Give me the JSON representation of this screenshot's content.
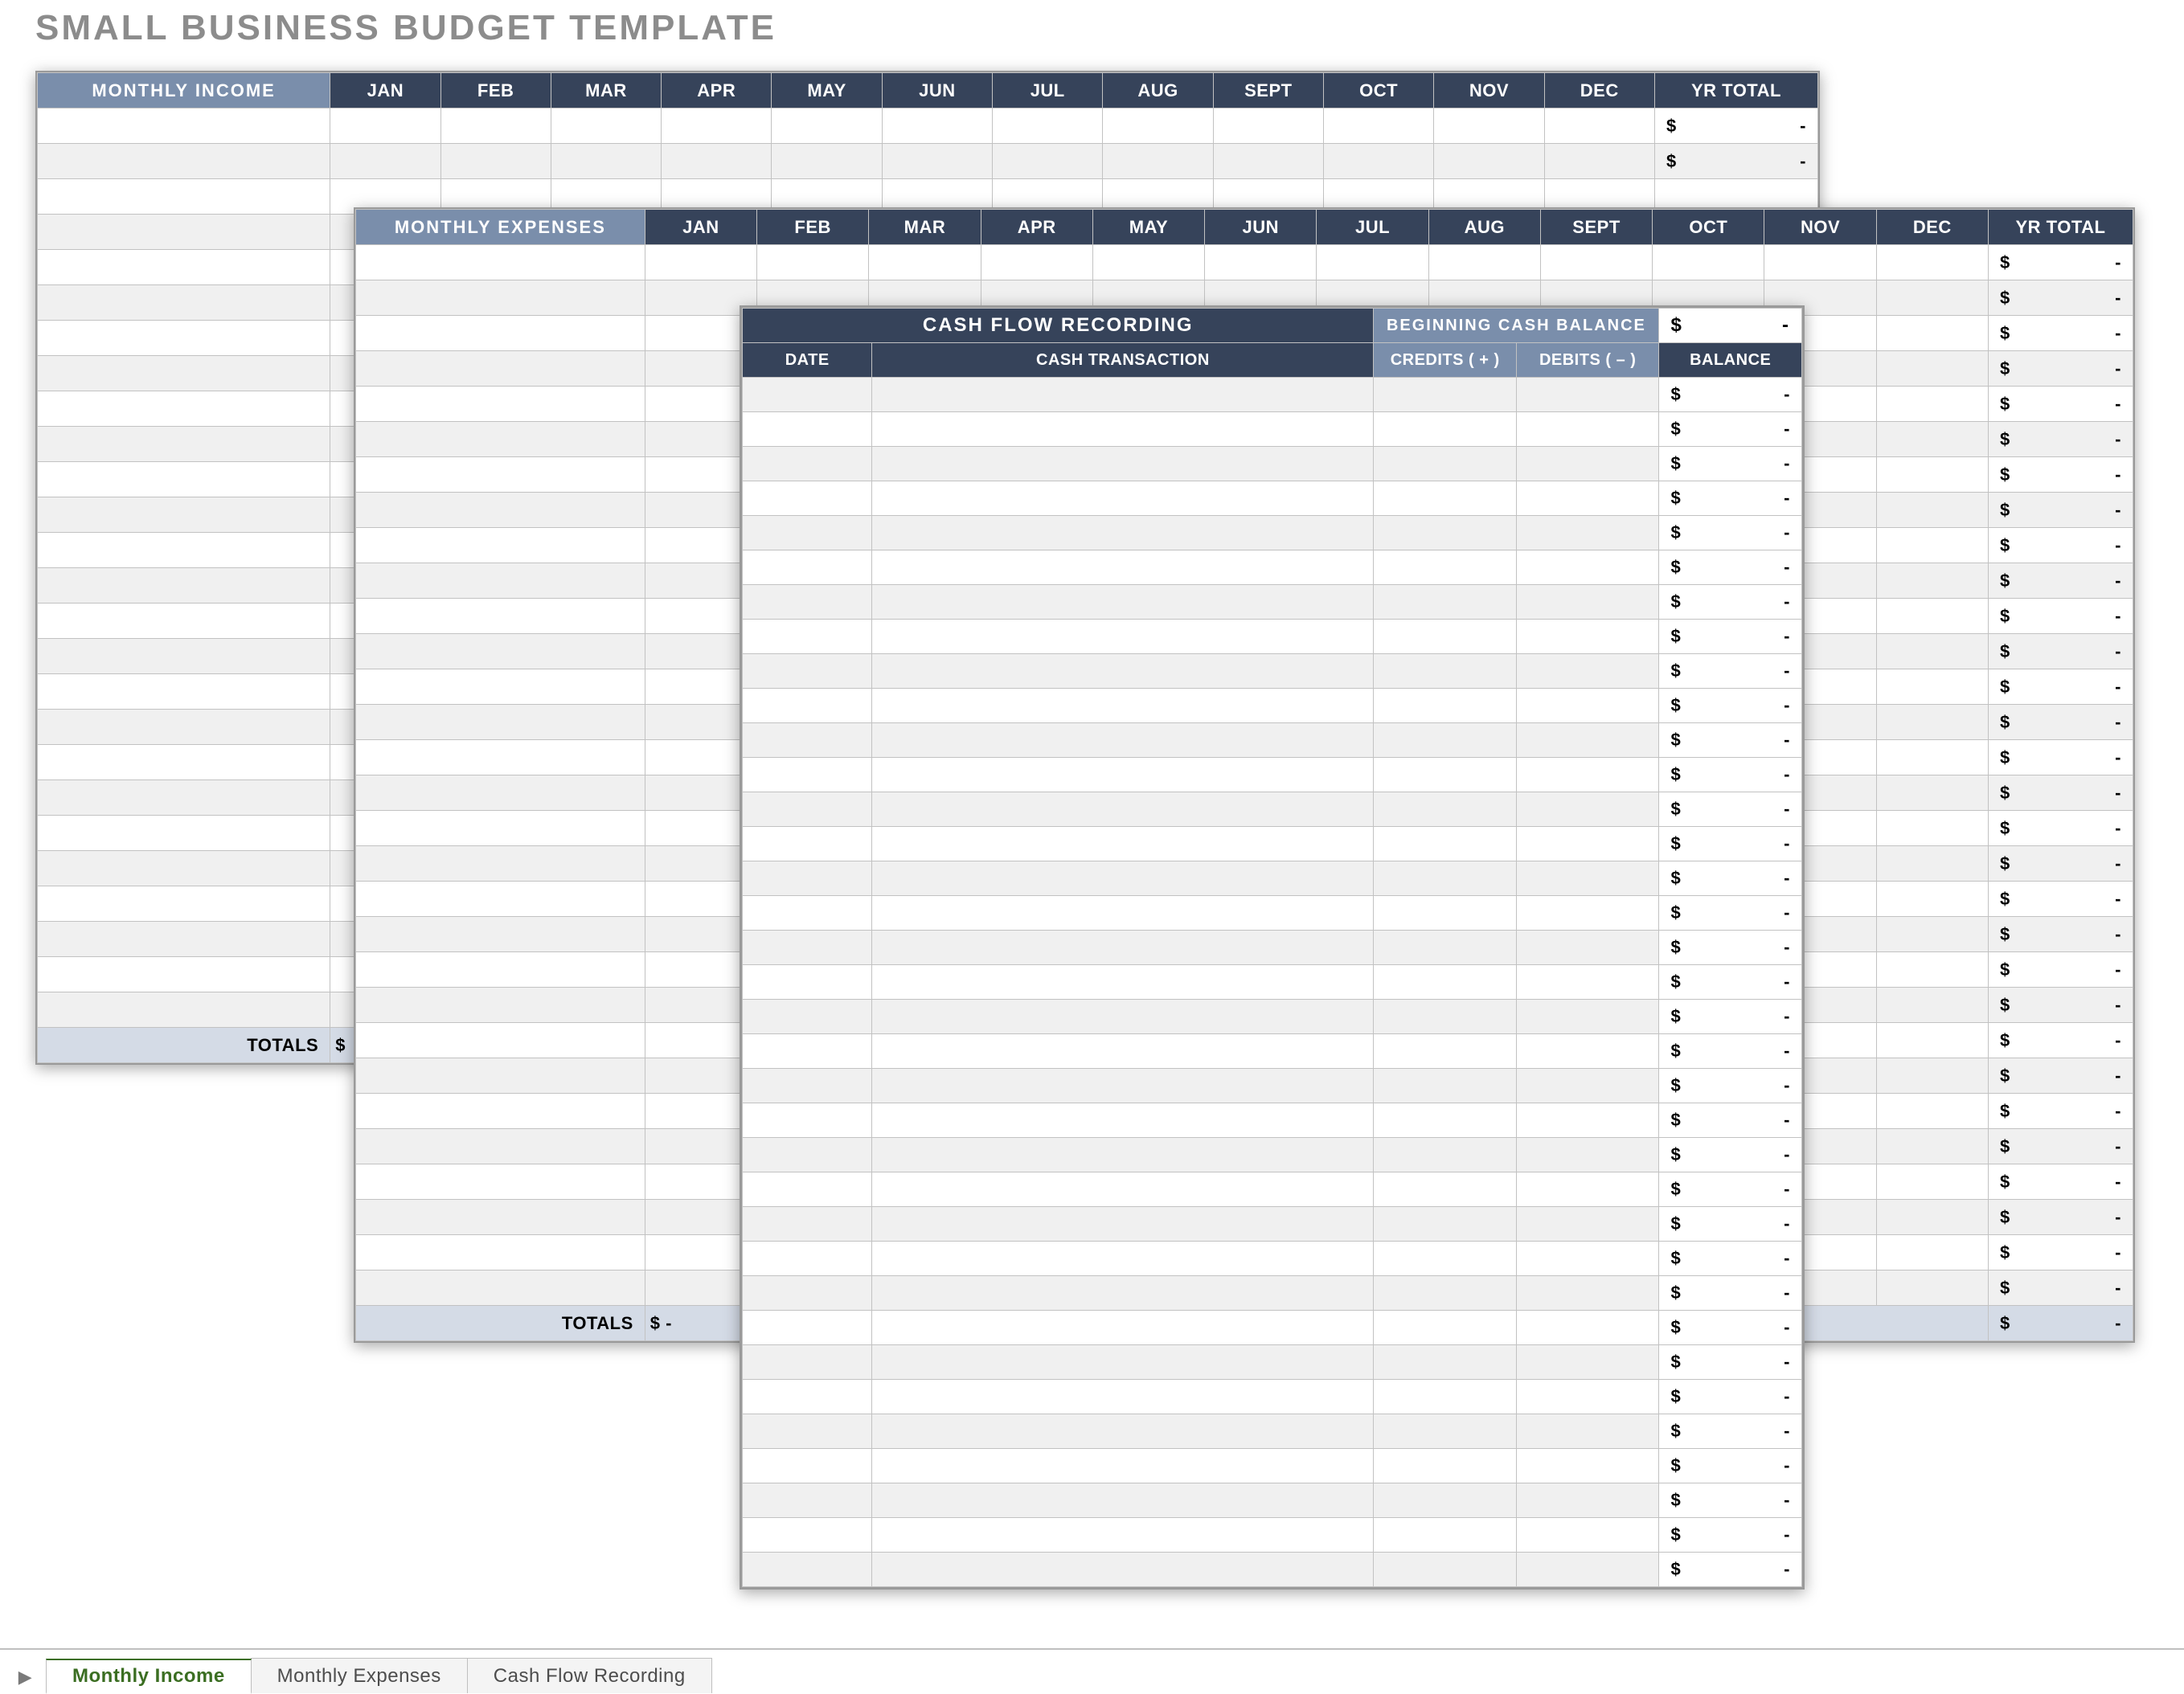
{
  "title": "SMALL BUSINESS BUDGET TEMPLATE",
  "months": [
    "JAN",
    "FEB",
    "MAR",
    "APR",
    "MAY",
    "JUN",
    "JUL",
    "AUG",
    "SEPT",
    "OCT",
    "NOV",
    "DEC"
  ],
  "yrTotal": "YR TOTAL",
  "moneyPlaceholder": {
    "sym": "$",
    "dash": "-"
  },
  "income": {
    "header": "MONTHLY INCOME",
    "rows": 26,
    "yrTotalRows": 2,
    "totalsLabel": "TOTALS",
    "totalsValue": "$"
  },
  "expenses": {
    "header": "MONTHLY EXPENSES",
    "rows": 30,
    "totalsLabel": "TOTALS",
    "totalsValue": "$          -"
  },
  "cashflow": {
    "title": "CASH FLOW RECORDING",
    "beginLabel": "BEGINNING CASH BALANCE",
    "cols": {
      "date": "DATE",
      "trans": "CASH TRANSACTION",
      "credits": "CREDITS ( + )",
      "debits": "DEBITS ( – )",
      "balance": "BALANCE"
    },
    "rows": 35
  },
  "tabs": {
    "list": [
      {
        "label": "Monthly Income",
        "active": true
      },
      {
        "label": "Monthly Expenses",
        "active": false
      },
      {
        "label": "Cash Flow Recording",
        "active": false
      }
    ]
  }
}
